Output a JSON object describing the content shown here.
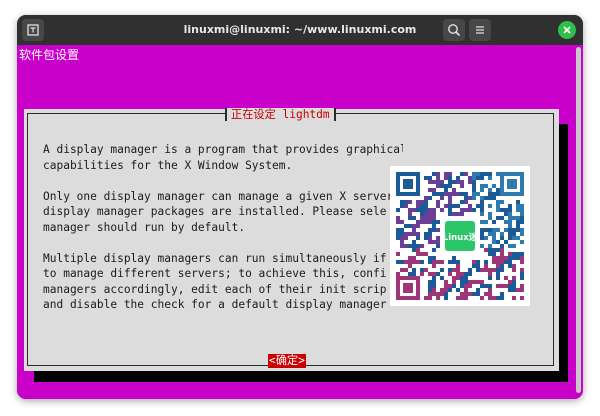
{
  "window": {
    "title": "linuxmi@linuxmi: ~/www.linuxmi.com"
  },
  "terminal": {
    "header": "软件包设置"
  },
  "dialog": {
    "title": "正在设定 lightdm",
    "paragraphs": [
      "A display manager is a program that provides graphical login\ncapabilities for the X Window System.",
      "Only one display manager can manage a given X server\ndisplay manager packages are installed. Please sele\nmanager should run by default.",
      "Multiple display managers can run simultaneously if\nto manage different servers; to achieve this, confi\nmanagers accordingly, edit each of their init scrip\nand disable the check for a default display manager"
    ],
    "ok_label": "<确定>"
  },
  "watermark": {
    "label": "Linux迷"
  },
  "colors": {
    "terminal_bg": "#c900c9",
    "dialog_bg": "#dcdcdc",
    "accent_red": "#c80000"
  },
  "icons": [
    "new-tab-icon",
    "search-icon",
    "menu-icon",
    "close-icon"
  ]
}
